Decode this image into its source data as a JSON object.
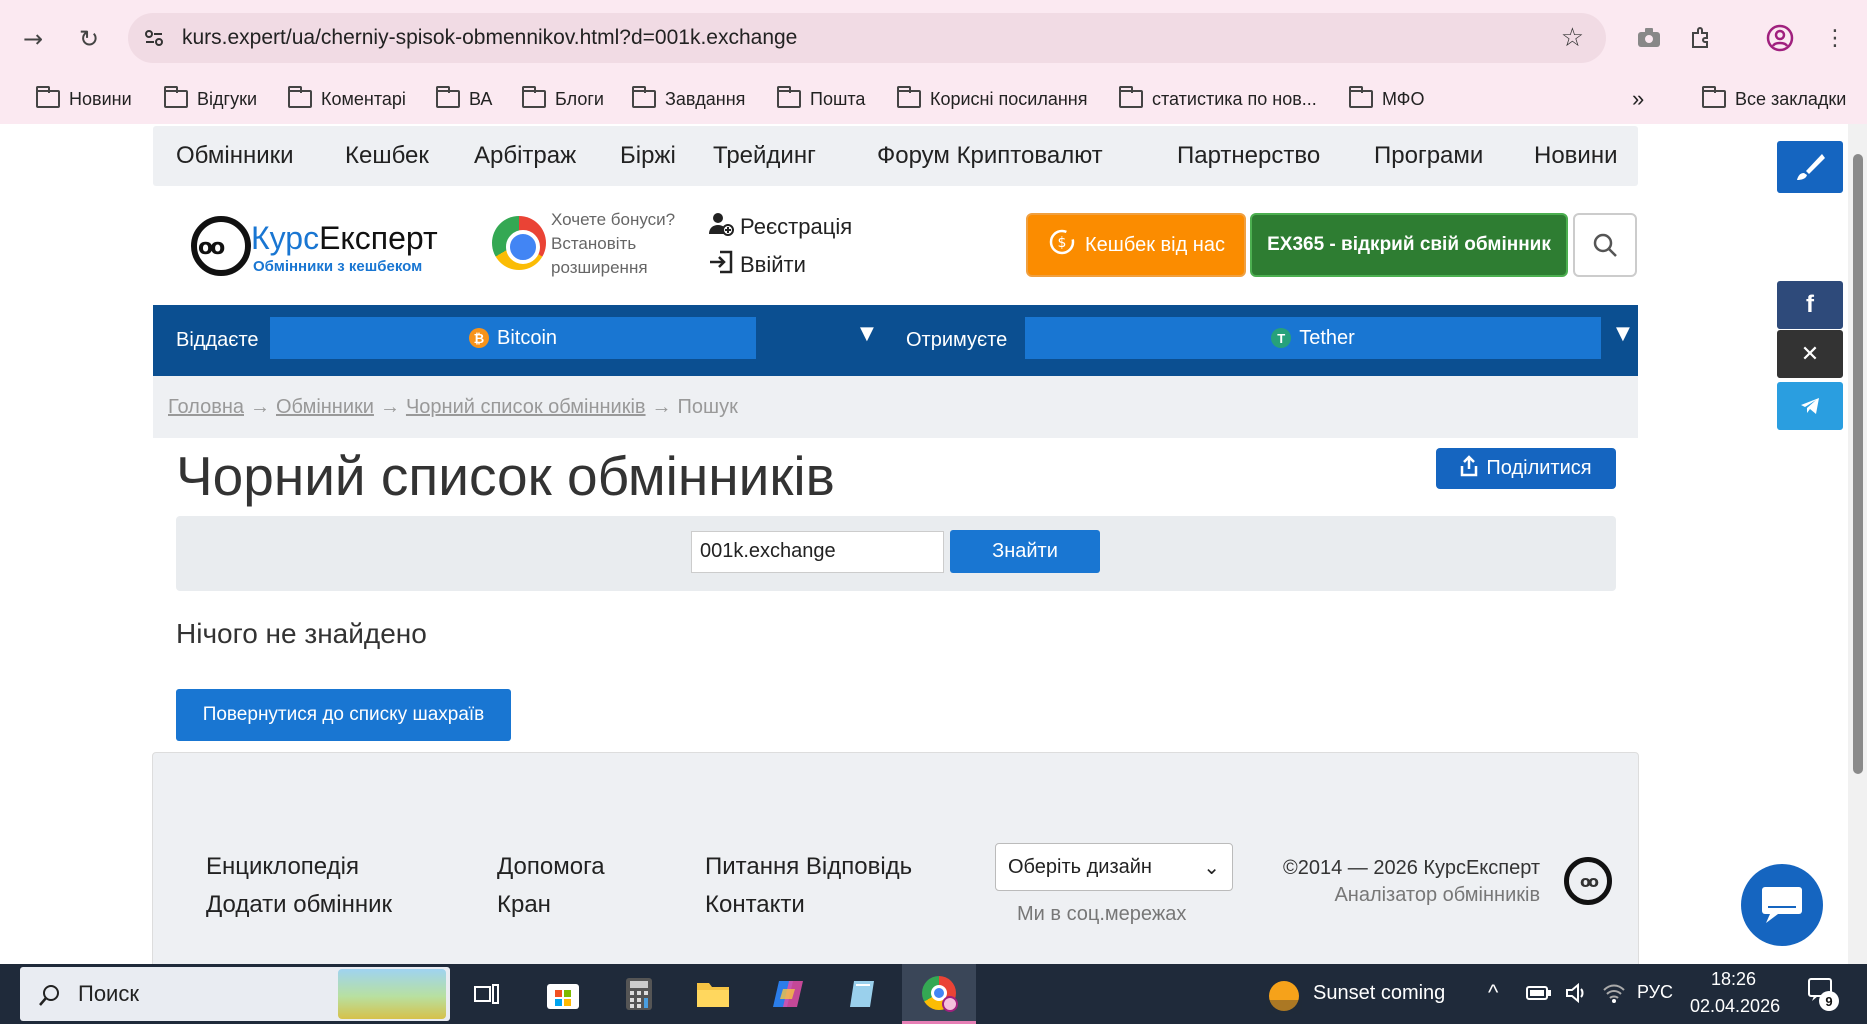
{
  "browser": {
    "url": "kurs.expert/ua/cherniy-spisok-obmennikov.html?d=001k.exchange",
    "bookmarks": [
      "Новини",
      "Відгуки",
      "Коментарі",
      "ВА",
      "Блоги",
      "Завдання",
      "Пошта",
      "Корисні посилання",
      "статистика по нов...",
      "МФО"
    ],
    "more_bookmarks": "»",
    "all_bookmarks": "Все закладки"
  },
  "nav": {
    "items": [
      "Обмінники",
      "Кешбек",
      "Арбітраж",
      "Біржі",
      "Трейдинг",
      "Форум Криптовалют",
      "Партнерство",
      "Програми",
      "Новини"
    ]
  },
  "header": {
    "logo_part1": "Курс",
    "logo_part2": "Експерт",
    "logo_sub": "Обмінники з кешбеком",
    "bonus_line1": "Хочете бонуси?",
    "bonus_line2": "Встановіть",
    "bonus_line3": "розширення",
    "register": "Реєстрація",
    "login": "Ввійти",
    "cashback_btn": "Кешбек від нас",
    "ex365_btn": "EX365 - відкрий свій обмінник"
  },
  "exchange": {
    "give_label": "Віддаєте",
    "give_coin": "Bitcoin",
    "get_label": "Отримуєте",
    "get_coin": "Tether"
  },
  "breadcrumb": {
    "home": "Головна",
    "exchangers": "Обмінники",
    "blacklist": "Чорний список обмінників",
    "current": "Пошук"
  },
  "main": {
    "title": "Чорний список обмінників",
    "share": "Поділитися",
    "search_value": "001k.exchange",
    "find_btn": "Знайти",
    "not_found": "Нічого не знайдено",
    "back_btn": "Повернутися до списку шахраїв"
  },
  "footer": {
    "col1": [
      "Енциклопедія",
      "Додати обмінник"
    ],
    "col2": [
      "Допомога",
      "Кран"
    ],
    "col3": [
      "Питання Відповідь",
      "Контакти"
    ],
    "design_select": "Оберіть дизайн",
    "social_caption": "Ми в соц.мережах",
    "copyright": "©2014 — 2026 КурсЕксперт",
    "copyright_sub": "Аналізатор обмінників"
  },
  "taskbar": {
    "search": "Поиск",
    "weather": "Sunset coming",
    "lang": "РУС",
    "time": "18:26",
    "date": "02.04.2026",
    "notifications": "9"
  },
  "colors": {
    "primary": "#1976d2",
    "dark_blue": "#0b4f91",
    "orange": "#fb8c00",
    "green": "#2e7d32",
    "chrome_bg": "#fbe9f1"
  }
}
